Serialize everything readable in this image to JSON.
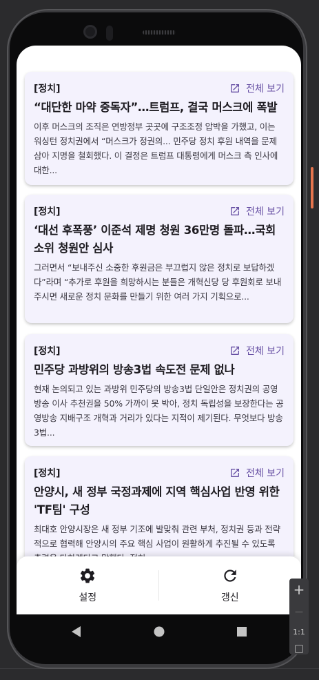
{
  "feed": {
    "cards": [
      {
        "category": "[정치]",
        "view_label": "전체 보기",
        "title": "“대단한 마약 중독자”…트럼프, 결국 머스크에 폭발",
        "summary": "이후 머스크의 조직은 연방정부 곳곳에 구조조정 압박을 가했고, 이는 워싱턴 정치권에서 “머스크가 정권의... 민주당 정치 후원 내역을 문제삼아 지명을 철회했다. 이 결정은 트럼프 대통령에게 머스크 측 인사에 대한..."
      },
      {
        "category": "[정치]",
        "view_label": "전체 보기",
        "title": "‘대선 후폭풍’ 이준석 제명 청원 36만명 돌파…국회 소위 청원안 심사",
        "summary": "그러면서 “보내주신 소중한 후원금은 부끄럽지 않은 정치로 보답하겠다”라며 “추가로 후원을 희망하시는 분들은 개혁신당 당 후원회로 보내주시면 새로운 정치 문화를 만들기 위한 여러 가지 기획으로..."
      },
      {
        "category": "[정치]",
        "view_label": "전체 보기",
        "title": "민주당 과방위의 방송3법 속도전 문제 없나",
        "summary": "현재 논의되고 있는 과방위 민주당의 방송3법 단일안은 정치권의 공영방송 이사 추천권을 50% 가까이 못 박아, 정치 독립성을 보장한다는 공영방송 지배구조 개혁과 거리가 있다는 지적이 제기된다. 무엇보다 방송3법..."
      },
      {
        "category": "[정치]",
        "view_label": "전체 보기",
        "title": "안양시, 새 정부 국정과제에 지역 핵심사업 반영 위한 'TF팀' 구성",
        "summary": "최대호 안양시장은 새 정부 기조에 발맞춰 관련 부처, 정치권 등과 전략적으로 협력해 안양시의 주요 핵심 사업이 원활하게 추진될 수 있도록 총력을 다하겠다고 말했다. 정혀..."
      }
    ]
  },
  "bottom_nav": {
    "settings_label": "설정",
    "refresh_label": "갱신"
  },
  "zoom_panel": {
    "plus": "+",
    "minus": "—",
    "ratio": "1:1"
  },
  "colors": {
    "card_bg": "#f4f2fd",
    "accent": "#6750a4",
    "text": "#1d1b20"
  }
}
